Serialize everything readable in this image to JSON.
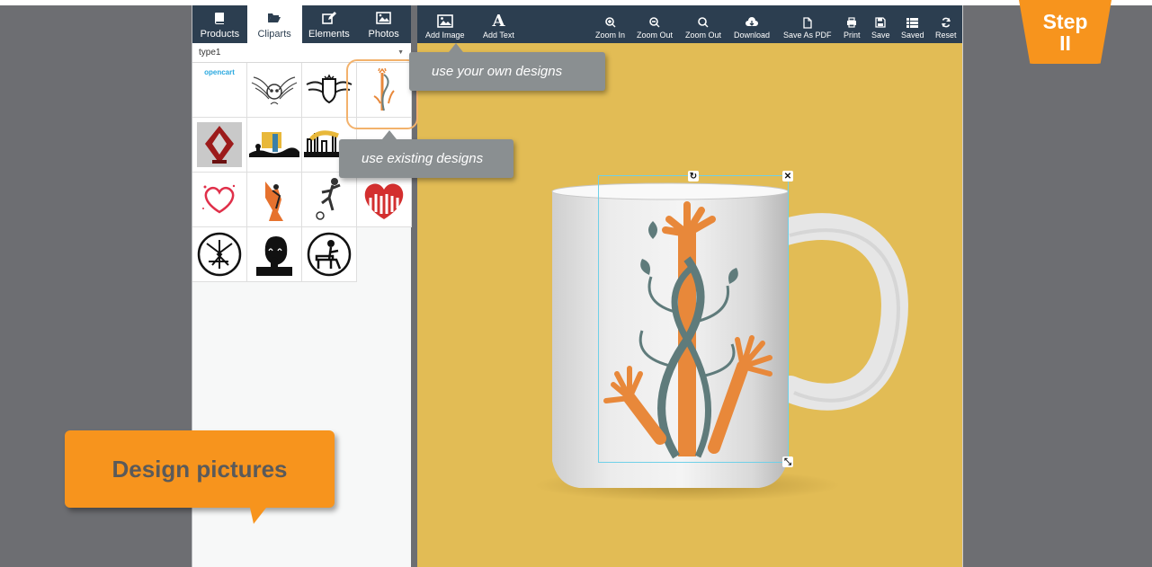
{
  "left_panel": {
    "tabs": [
      {
        "label": "Products",
        "icon": "book-icon"
      },
      {
        "label": "Cliparts",
        "icon": "folder-open-icon",
        "active": true
      },
      {
        "label": "Elements",
        "icon": "edit-icon"
      },
      {
        "label": "Photos",
        "icon": "image-icon"
      }
    ],
    "type_select": {
      "value": "type1"
    },
    "clipart_logo_text": "opencart"
  },
  "toolbar": {
    "add_image": "Add Image",
    "add_text": "Add Text",
    "zoom_in": "Zoom In",
    "zoom_out_1": "Zoom Out",
    "zoom_out_2": "Zoom Out",
    "download": "Download",
    "save_as_pdf": "Save As PDF",
    "print": "Print",
    "save": "Save",
    "saved": "Saved",
    "reset": "Reset"
  },
  "callouts": {
    "own_designs": "use your own designs",
    "existing_designs": "use existing designs",
    "design_pictures": "Design pictures",
    "step": "Step",
    "step_number": "II"
  },
  "colors": {
    "toolbar_bg": "#2c3e50",
    "canvas_bg": "#e2bc55",
    "accent_orange": "#f7941d",
    "callout_gray": "#8a8f91",
    "stage_gray": "#6d6e72"
  }
}
